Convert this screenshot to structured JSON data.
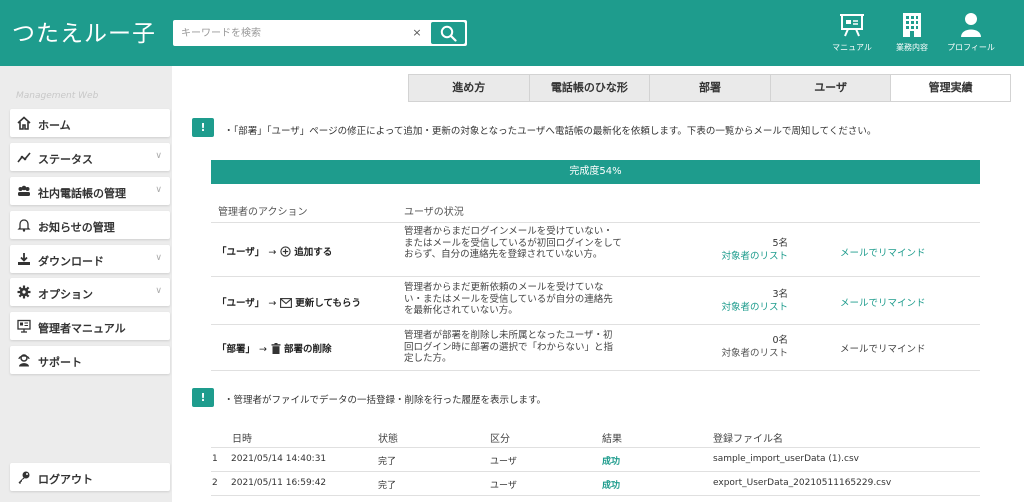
{
  "header": {
    "logo": "つたえルー子",
    "search_placeholder": "キーワードを検索",
    "clear_label": "×",
    "nav": [
      {
        "label": "マニュアル",
        "icon": "presentation-board-icon"
      },
      {
        "label": "業務内容",
        "icon": "building-icon"
      },
      {
        "label": "プロフィール",
        "icon": "user-icon"
      }
    ]
  },
  "sidebar": {
    "brand_note": "Management Web",
    "items": [
      {
        "label": "ホーム",
        "icon": "home-icon",
        "chevron": ""
      },
      {
        "label": "ステータス",
        "icon": "status-chart-icon",
        "chevron": "∨"
      },
      {
        "label": "社内電話帳の管理",
        "icon": "group-icon",
        "chevron": "∨"
      },
      {
        "label": "お知らせの管理",
        "icon": "bell-icon",
        "chevron": ""
      },
      {
        "label": "ダウンロード",
        "icon": "download-icon",
        "chevron": "∨"
      },
      {
        "label": "オプション",
        "icon": "gear-icon",
        "chevron": "∨"
      },
      {
        "label": "管理者マニュアル",
        "icon": "manual-icon",
        "chevron": ""
      },
      {
        "label": "サポート",
        "icon": "support-icon",
        "chevron": ""
      }
    ],
    "logout": {
      "label": "ログアウト",
      "icon": "key-icon"
    }
  },
  "tabs": [
    "進め方",
    "電話帳のひな形",
    "部署",
    "ユーザ",
    "管理実績"
  ],
  "active_tab": "管理実績",
  "notice1": {
    "icon_text": "!",
    "text": "・「部署」「ユーザ」ページの修正によって追加・更新の対象となったユーザへ電話帳の最新化を依頼します。下表の一覧からメールで周知してください。"
  },
  "progress": {
    "label": "完成度54%",
    "value_percent": 54
  },
  "actions": {
    "col_action": "管理者のアクション",
    "col_status": "ユーザの状況",
    "rows": [
      {
        "target": "「ユーザ」",
        "arrow": "→",
        "action": "追加する",
        "action_icon": "plus-circle-icon",
        "desc": "管理者からまだログインメールを受けていない・またはメールを受信しているが初回ログインをしておらず、自分の連絡先を登録されていない方。",
        "count": "5名",
        "list_link": "対象者のリスト",
        "remind": "メールでリマインド",
        "enabled": true
      },
      {
        "target": "「ユーザ」",
        "arrow": "→",
        "action": "更新してもらう",
        "action_icon": "envelope-icon",
        "desc": "管理者からまだ更新依頼のメールを受けていない・またはメールを受信しているが自分の連絡先を最新化されていない方。",
        "count": "3名",
        "list_link": "対象者のリスト",
        "remind": "メールでリマインド",
        "enabled": true
      },
      {
        "target": "「部署」",
        "arrow": "→",
        "action": "部署の削除",
        "action_icon": "trash-icon",
        "desc": "管理者が部署を削除し未所属となったユーザ・初回ログイン時に部署の選択で「わからない」と指定した方。",
        "count": "0名",
        "list_link": "対象者のリスト",
        "remind": "メールでリマインド",
        "enabled": false
      }
    ]
  },
  "notice2": {
    "icon_text": "!",
    "text": "・管理者がファイルでデータの一括登録・削除を行った履歴を表示します。"
  },
  "history": {
    "headers": [
      "日時",
      "状態",
      "区分",
      "結果",
      "登録ファイル名"
    ],
    "rows": [
      {
        "no": "1",
        "datetime": "2021/05/14 14:40:31",
        "state": "完了",
        "kind": "ユーザ",
        "result": "成功",
        "file": "sample_import_userData (1).csv"
      },
      {
        "no": "2",
        "datetime": "2021/05/11 16:59:42",
        "state": "完了",
        "kind": "ユーザ",
        "result": "成功",
        "file": "export_UserData_20210511165229.csv"
      }
    ]
  },
  "colors": {
    "brand": "#1e9c8d",
    "sidebar_bg": "#ececec"
  }
}
